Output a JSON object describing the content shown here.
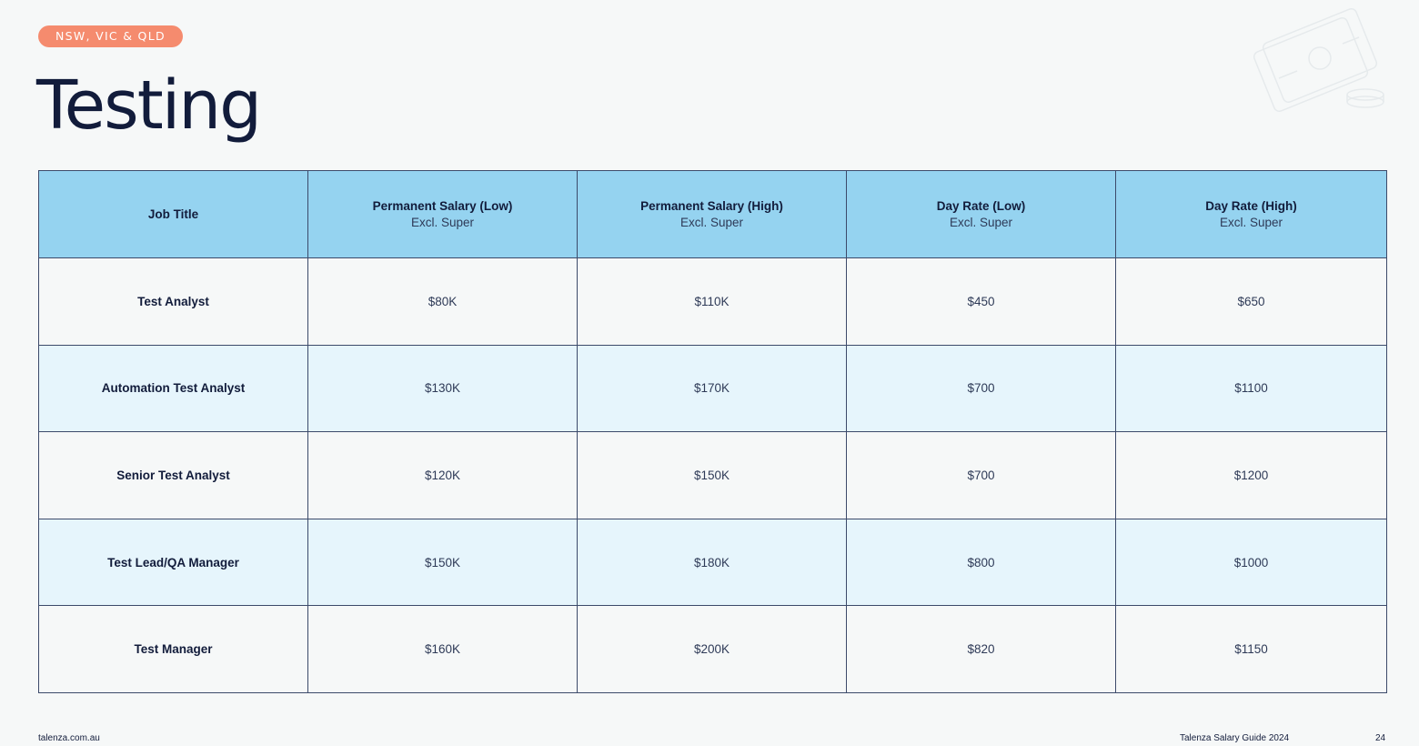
{
  "badge": "NSW, VIC & QLD",
  "title": "Testing",
  "decoration_icon": "money-notes-icon",
  "colors": {
    "badge": "#f58b6e",
    "header_row": "#95d3f0",
    "alt_row": "#e6f5fc",
    "text": "#121c3b",
    "border": "#3c4a6a"
  },
  "table": {
    "headers": [
      {
        "main": "Job Title",
        "sub": ""
      },
      {
        "main": "Permanent Salary (Low)",
        "sub": "Excl. Super"
      },
      {
        "main": "Permanent Salary (High)",
        "sub": "Excl. Super"
      },
      {
        "main": "Day Rate (Low)",
        "sub": "Excl. Super"
      },
      {
        "main": "Day Rate (High)",
        "sub": "Excl. Super"
      }
    ],
    "rows": [
      {
        "title": "Test Analyst",
        "perm_low": "$80K",
        "perm_high": "$110K",
        "day_low": "$450",
        "day_high": "$650"
      },
      {
        "title": "Automation Test Analyst",
        "perm_low": "$130K",
        "perm_high": "$170K",
        "day_low": "$700",
        "day_high": "$1100"
      },
      {
        "title": "Senior Test Analyst",
        "perm_low": "$120K",
        "perm_high": "$150K",
        "day_low": "$700",
        "day_high": "$1200"
      },
      {
        "title": "Test Lead/QA Manager",
        "perm_low": "$150K",
        "perm_high": "$180K",
        "day_low": "$800",
        "day_high": "$1000"
      },
      {
        "title": "Test Manager",
        "perm_low": "$160K",
        "perm_high": "$200K",
        "day_low": "$820",
        "day_high": "$1150"
      }
    ]
  },
  "footer": {
    "website": "talenza.com.au",
    "guide": "Talenza Salary Guide 2024",
    "page_number": "24"
  }
}
